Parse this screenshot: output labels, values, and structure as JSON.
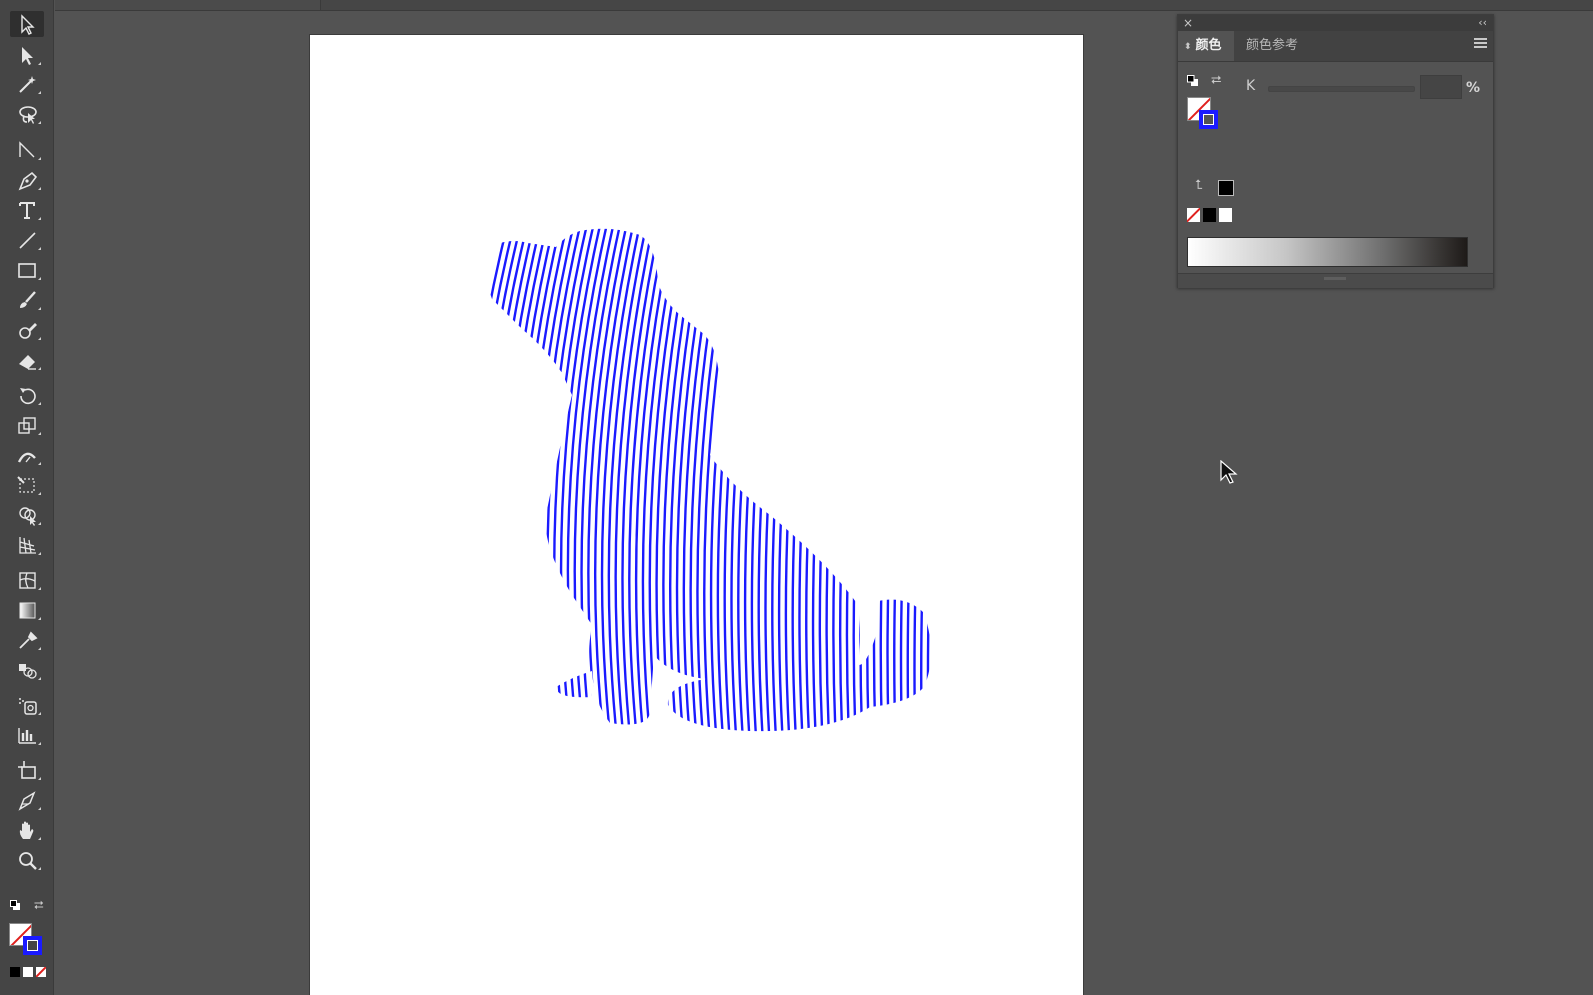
{
  "toolbar": {
    "tools": [
      {
        "name": "selection-tool-icon",
        "active": true
      },
      {
        "name": "direct-selection-tool-icon"
      },
      {
        "name": "magic-wand-tool-icon"
      },
      {
        "name": "lasso-tool-icon"
      },
      {
        "name": "direct-line-tool-icon"
      },
      {
        "name": "pen-tool-icon"
      },
      {
        "name": "type-tool-icon"
      },
      {
        "name": "line-segment-tool-icon"
      },
      {
        "name": "rectangle-tool-icon"
      },
      {
        "name": "paintbrush-tool-icon"
      },
      {
        "name": "shaper-tool-icon"
      },
      {
        "name": "eraser-tool-icon"
      },
      {
        "name": "rotate-tool-icon"
      },
      {
        "name": "scale-tool-icon"
      },
      {
        "name": "width-tool-icon"
      },
      {
        "name": "free-transform-tool-icon"
      },
      {
        "name": "shape-builder-tool-icon"
      },
      {
        "name": "perspective-grid-tool-icon"
      },
      {
        "name": "mesh-tool-icon"
      },
      {
        "name": "gradient-tool-icon"
      },
      {
        "name": "eyedropper-tool-icon"
      },
      {
        "name": "blend-tool-icon"
      },
      {
        "name": "symbol-sprayer-tool-icon"
      },
      {
        "name": "column-graph-tool-icon"
      },
      {
        "name": "artboard-tool-icon"
      },
      {
        "name": "slice-tool-icon"
      },
      {
        "name": "hand-tool-icon"
      },
      {
        "name": "zoom-tool-icon"
      }
    ],
    "fill": "none",
    "stroke_color": "#1a1aff"
  },
  "color_panel": {
    "close_glyph": "×",
    "collapse_glyph": "‹‹",
    "tabs": {
      "color": "颜色",
      "color_guide": "颜色参考"
    },
    "swap_glyph": "⮂",
    "slider_label": "K",
    "k_value": "",
    "unit": "%",
    "out_of_gamut_glyph": "⮤",
    "ramp_colors": [
      "#ffffff",
      "#1e1a18"
    ]
  },
  "artwork": {
    "stroke_color": "#1a1aff",
    "line_count": 70
  }
}
